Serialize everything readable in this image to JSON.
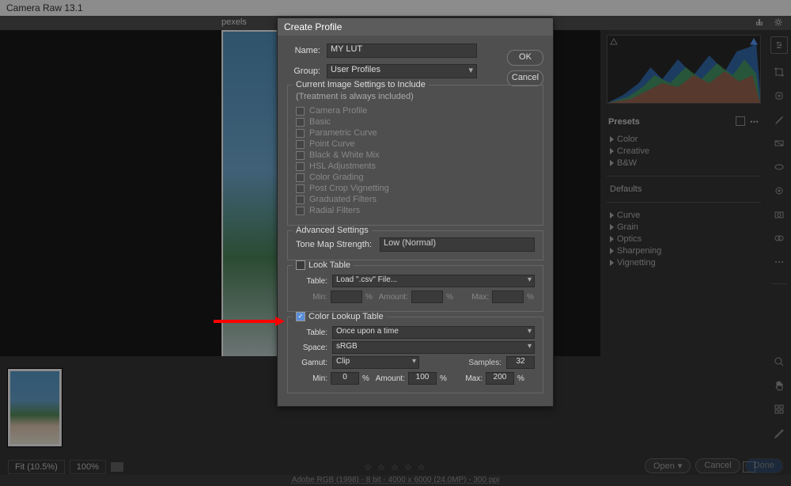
{
  "app_title": "Camera Raw 13.1",
  "file_name": "pexels",
  "dialog": {
    "title": "Create Profile",
    "name_label": "Name:",
    "name_value": "MY LUT",
    "group_label": "Group:",
    "group_value": "User Profiles",
    "ok": "OK",
    "cancel": "Cancel",
    "include_legend": "Current Image Settings to Include",
    "treatment_note": "(Treatment is always included)",
    "includes": [
      "Camera Profile",
      "Basic",
      "Parametric Curve",
      "Point Curve",
      "Black & White Mix",
      "HSL Adjustments",
      "Color Grading",
      "Post Crop Vignetting",
      "Graduated Filters",
      "Radial Filters"
    ],
    "adv_legend": "Advanced Settings",
    "tone_map_label": "Tone Map Strength:",
    "tone_map_value": "Low (Normal)",
    "look_legend": "Look Table",
    "look_table_label": "Table:",
    "look_table_value": "Load \".csv\" File...",
    "look_min": "Min:",
    "look_amount": "Amount:",
    "look_max": "Max:",
    "pct": "%",
    "color_lookup_legend": "Color Lookup Table",
    "clt_table_label": "Table:",
    "clt_table_value": "Once upon a time",
    "clt_space_label": "Space:",
    "clt_space_value": "sRGB",
    "clt_gamut_label": "Gamut:",
    "clt_gamut_value": "Clip",
    "clt_samples_label": "Samples:",
    "clt_samples_value": "32",
    "clt_min_label": "Min:",
    "clt_min_value": "0",
    "clt_amount_label": "Amount:",
    "clt_amount_value": "100",
    "clt_max_label": "Max:",
    "clt_max_value": "200"
  },
  "sidepanel": {
    "presets_title": "Presets",
    "groups1": [
      "Color",
      "Creative",
      "B&W"
    ],
    "defaults": "Defaults",
    "groups2": [
      "Curve",
      "Grain",
      "Optics",
      "Sharpening",
      "Vignetting"
    ]
  },
  "bottom": {
    "fit": "Fit (10.5%)",
    "zoom": "100%",
    "stars": "☆ ☆ ☆ ☆ ☆",
    "open": "Open",
    "cancel": "Cancel",
    "done": "Done"
  },
  "meta": "Adobe RGB (1998) - 8 bit - 4000 x 6000 (24.0MP) - 300 ppi"
}
